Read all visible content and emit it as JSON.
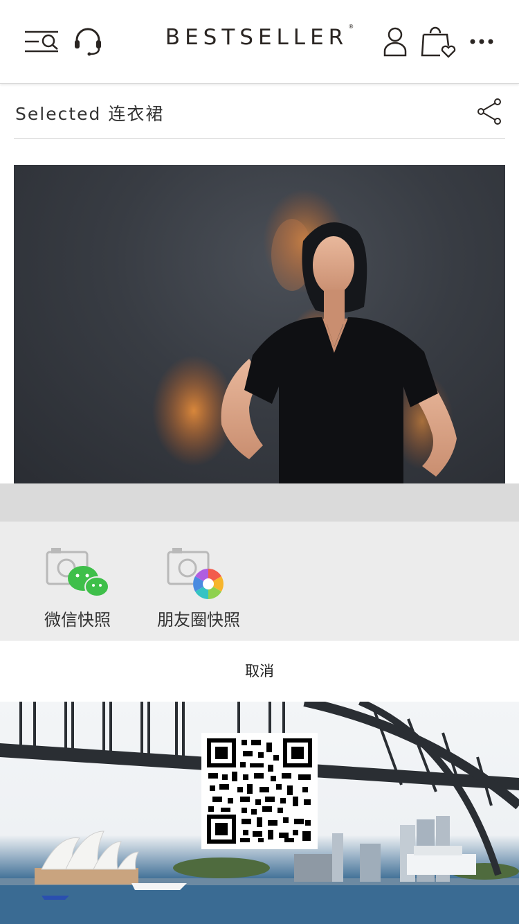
{
  "header": {
    "brand": "BESTSELLER",
    "brand_mark": "®",
    "icons": {
      "menu": "menu-search-icon",
      "support": "headset-icon",
      "account": "user-icon",
      "bag": "shopping-bag-heart-icon",
      "more": "more-dots-icon"
    }
  },
  "subheader": {
    "crumb": "Selected 连衣裙",
    "share_icon": "share-icon"
  },
  "share_sheet": {
    "items": [
      {
        "label": "微信快照",
        "icon": "wechat-snapshot-icon"
      },
      {
        "label": "朋友圈快照",
        "icon": "moments-snapshot-icon"
      }
    ],
    "cancel_label": "取消"
  },
  "poster": {
    "qr_icon": "qr-code"
  },
  "colors": {
    "sheet_bg": "#ececec",
    "overlay_band": "#dadada",
    "wechat_green": "#3fbf4a"
  }
}
